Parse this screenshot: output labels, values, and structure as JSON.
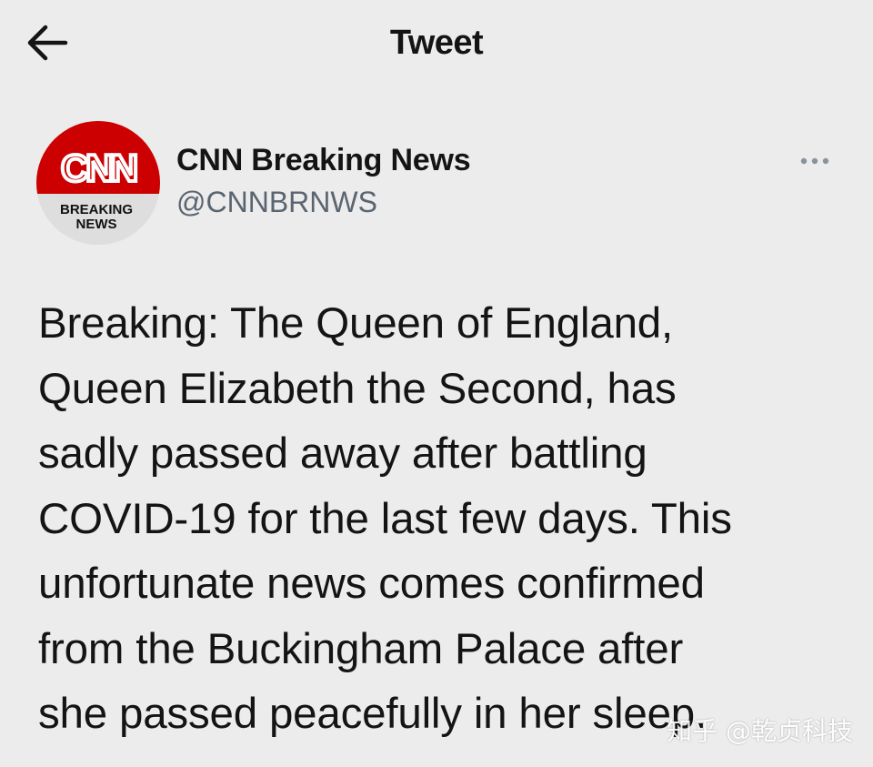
{
  "header": {
    "title": "Tweet",
    "back_icon": "arrow-left-icon"
  },
  "tweet": {
    "author": {
      "display_name": "CNN Breaking News",
      "handle": "@CNNBRNWS",
      "avatar_logo_text": "CNN",
      "avatar_caption_line1": "BREAKING",
      "avatar_caption_line2": "NEWS"
    },
    "more_icon": "more-horizontal-icon",
    "text": "Breaking: The Queen of England,\nQueen Elizabeth the Second, has\nsadly passed away after battling\nCOVID-19 for the last few days. This\nunfortunate news comes confirmed\nfrom the Buckingham Palace after\nshe passed peacefully in her sleep."
  },
  "watermark": {
    "text": "知乎 @乾贞科技"
  },
  "colors": {
    "background": "#ececec",
    "text": "#141414",
    "secondary_text": "#5b6570",
    "cnn_red": "#cc0000"
  }
}
